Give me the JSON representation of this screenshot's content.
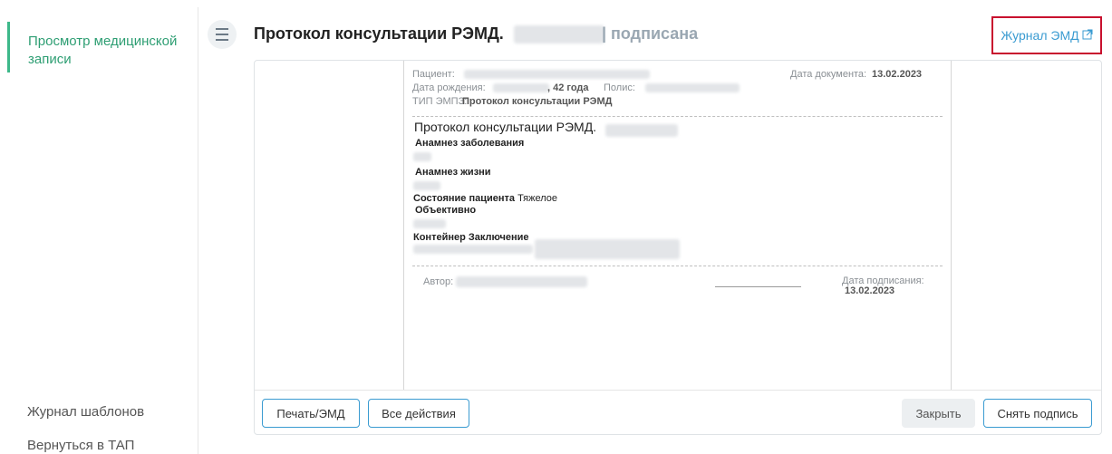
{
  "sidebar": {
    "active_item": "Просмотр медицинской записи",
    "templates_label": "Журнал шаблонов",
    "back_label": "Вернуться в ТАП"
  },
  "header": {
    "title": "Протокол консультации РЭМД.",
    "status": "| подписана",
    "journal_link": "Журнал ЭМД"
  },
  "document": {
    "patient_label": "Пациент:",
    "doc_date_label": "Дата документа:",
    "doc_date_value": "13.02.2023",
    "birth_label": "Дата рождения:",
    "age_value": ", 42 года",
    "policy_label": "Полис:",
    "type_label": "ТИП ЭМПЗ:",
    "type_value": "Протокол консультации РЭМД",
    "heading": "Протокол консультации РЭМД.",
    "anamnesis_disease": "Анамнез заболевания",
    "anamnesis_life": "Анамнез жизни",
    "patient_state_label": "Состояние пациента",
    "patient_state_value": "Тяжелое",
    "objective": "Объективно",
    "conclusion": "Контейнер Заключение",
    "author_label": "Автор:",
    "sign_date_label": "Дата подписания:",
    "sign_date_value": "13.02.2023"
  },
  "footer": {
    "print_button": "Печать/ЭМД",
    "all_actions_button": "Все действия",
    "close_button": "Закрыть",
    "unsign_button": "Снять подпись"
  },
  "colors": {
    "accent_green": "#3db88a",
    "link_blue": "#3a9bd1",
    "highlight_red": "#c8102e"
  }
}
